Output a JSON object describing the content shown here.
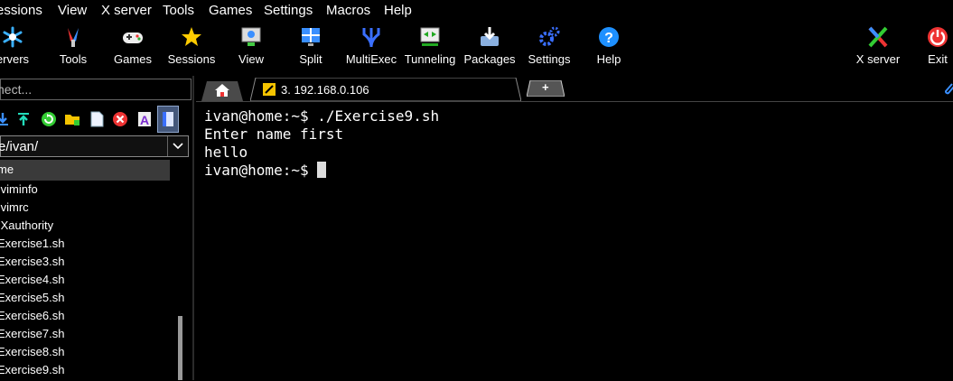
{
  "menu": [
    "essions",
    "View",
    "X server",
    "Tools",
    "Games",
    "Settings",
    "Macros",
    "Help"
  ],
  "toolbar": [
    {
      "label": "ervers",
      "icon": "servers-icon"
    },
    {
      "label": "Tools",
      "icon": "tools-icon"
    },
    {
      "label": "Games",
      "icon": "gamepad-icon"
    },
    {
      "label": "Sessions",
      "icon": "star-icon"
    },
    {
      "label": "View",
      "icon": "view-icon"
    },
    {
      "label": "Split",
      "icon": "split-icon"
    },
    {
      "label": "MultiExec",
      "icon": "multiexec-icon"
    },
    {
      "label": "Tunneling",
      "icon": "tunneling-icon"
    },
    {
      "label": "Packages",
      "icon": "packages-icon"
    },
    {
      "label": "Settings",
      "icon": "gears-icon"
    },
    {
      "label": "Help",
      "icon": "help-icon"
    },
    {
      "label": "X server",
      "icon": "x-server-icon"
    },
    {
      "label": "Exit",
      "icon": "power-icon"
    }
  ],
  "quickconnect": {
    "placeholder": "nect..."
  },
  "sftp": {
    "path": "e/ivan/",
    "header": "me",
    "files": [
      ".viminfo",
      ".vimrc",
      ".Xauthority",
      "Exercise1.sh",
      "Exercise3.sh",
      "Exercise4.sh",
      "Exercise5.sh",
      "Exercise6.sh",
      "Exercise7.sh",
      "Exercise8.sh",
      "Exercise9.sh"
    ]
  },
  "tabs": {
    "active_title": "3. 192.168.0.106",
    "close_glyph": "✕",
    "new_glyph": "+"
  },
  "terminal": {
    "lines": [
      "ivan@home:~$ ./Exercise9.sh",
      "Enter name first",
      "hello",
      "ivan@home:~$ "
    ]
  },
  "colors": {
    "accent": "#1e90ff",
    "background": "#000000"
  }
}
